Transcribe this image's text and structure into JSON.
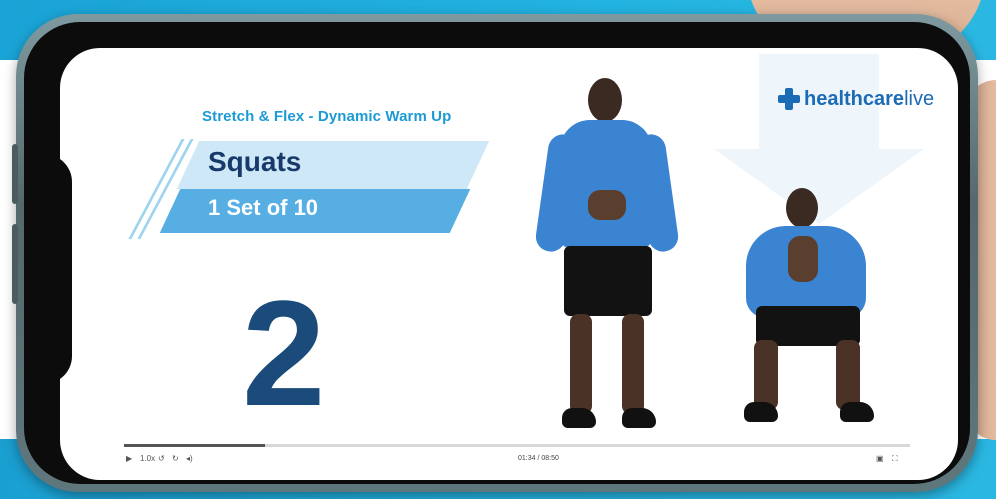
{
  "video": {
    "subtitle": "Stretch & Flex - Dynamic Warm Up",
    "exercise_title": "Squats",
    "sets_reps": "1 Set of 10",
    "countdown": "2",
    "logo_bold": "healthcare",
    "logo_light": "live",
    "time": "01:34 / 08:50",
    "progress_fraction": 0.18
  },
  "controls": {
    "play_icon": "play-icon",
    "speed": "1.0x",
    "rewind_icon": "rewind-icon",
    "forward_icon": "forward-icon",
    "volume_icon": "volume-icon",
    "cc_icon": "captions-icon",
    "fullscreen_icon": "fullscreen-icon"
  },
  "colors": {
    "accent_blue": "#1c9ad6",
    "title_navy": "#173a6b",
    "banner_light": "#cfe8f7",
    "banner_dark": "#56aee3"
  }
}
